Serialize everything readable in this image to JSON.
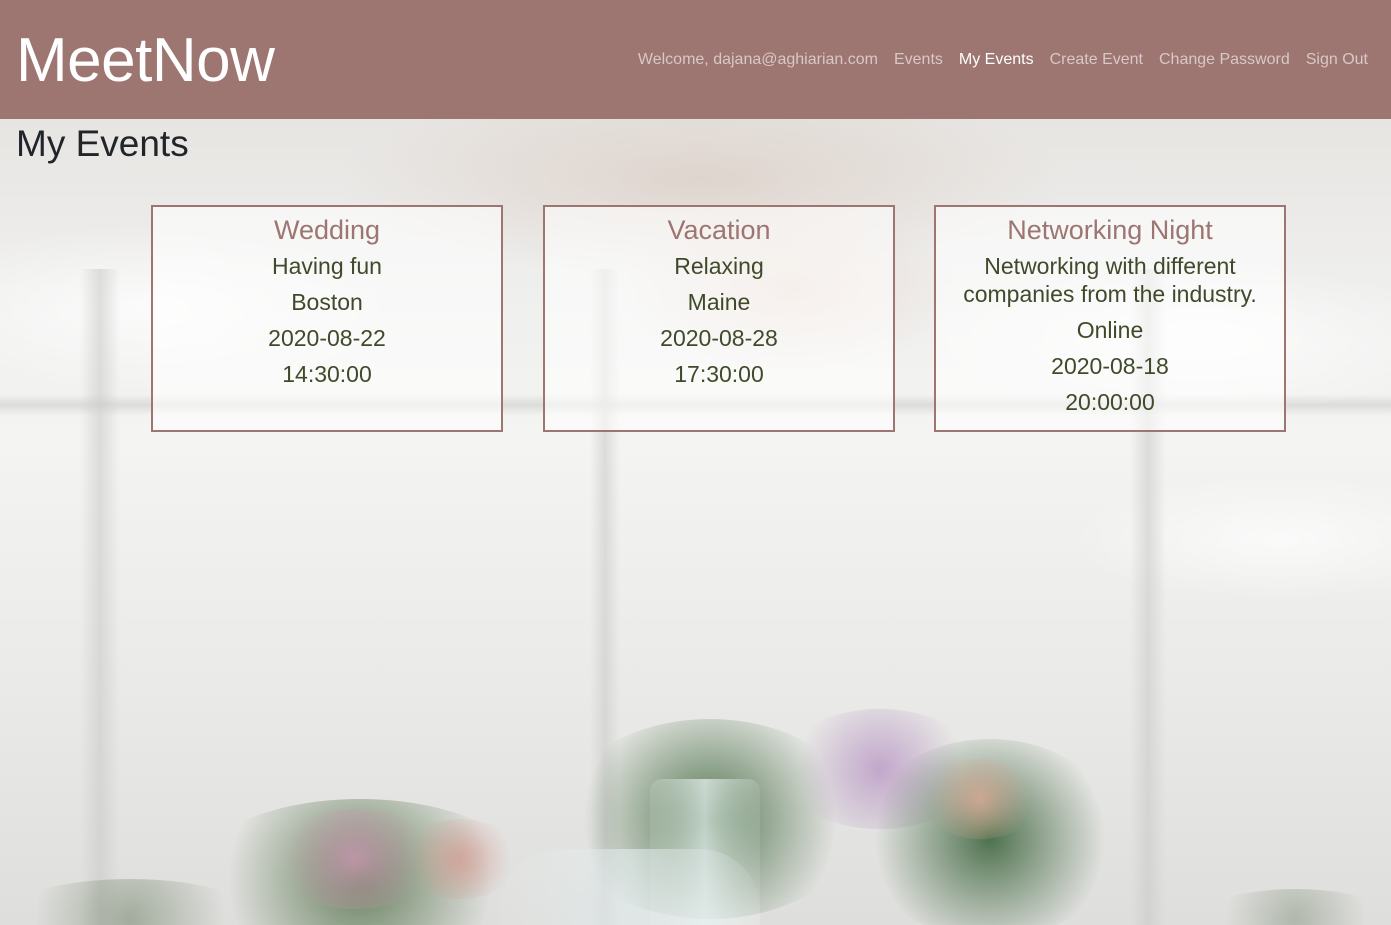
{
  "navbar": {
    "brand": "MeetNow",
    "welcome": "Welcome, dajana@aghiarian.com",
    "links": [
      {
        "label": "Events",
        "active": false
      },
      {
        "label": "My Events",
        "active": true
      },
      {
        "label": "Create Event",
        "active": false
      },
      {
        "label": "Change Password",
        "active": false
      },
      {
        "label": "Sign Out",
        "active": false
      }
    ]
  },
  "main": {
    "title": "My Events",
    "events": [
      {
        "title": "Wedding",
        "description": "Having fun",
        "location": "Boston",
        "date": "2020-08-22",
        "time": "14:30:00"
      },
      {
        "title": "Vacation",
        "description": "Relaxing",
        "location": "Maine",
        "date": "2020-08-28",
        "time": "17:30:00"
      },
      {
        "title": "Networking Night",
        "description": "Networking with different companies from the industry.",
        "location": "Online",
        "date": "2020-08-18",
        "time": "20:00:00"
      }
    ]
  },
  "colors": {
    "navbar_bg": "#9d7571",
    "card_border": "#9d7571",
    "card_title": "#9d7571",
    "card_text": "#3f4a2a",
    "nav_active": "#ffffff",
    "nav_inactive": "rgba(255,255,255,0.6)"
  }
}
